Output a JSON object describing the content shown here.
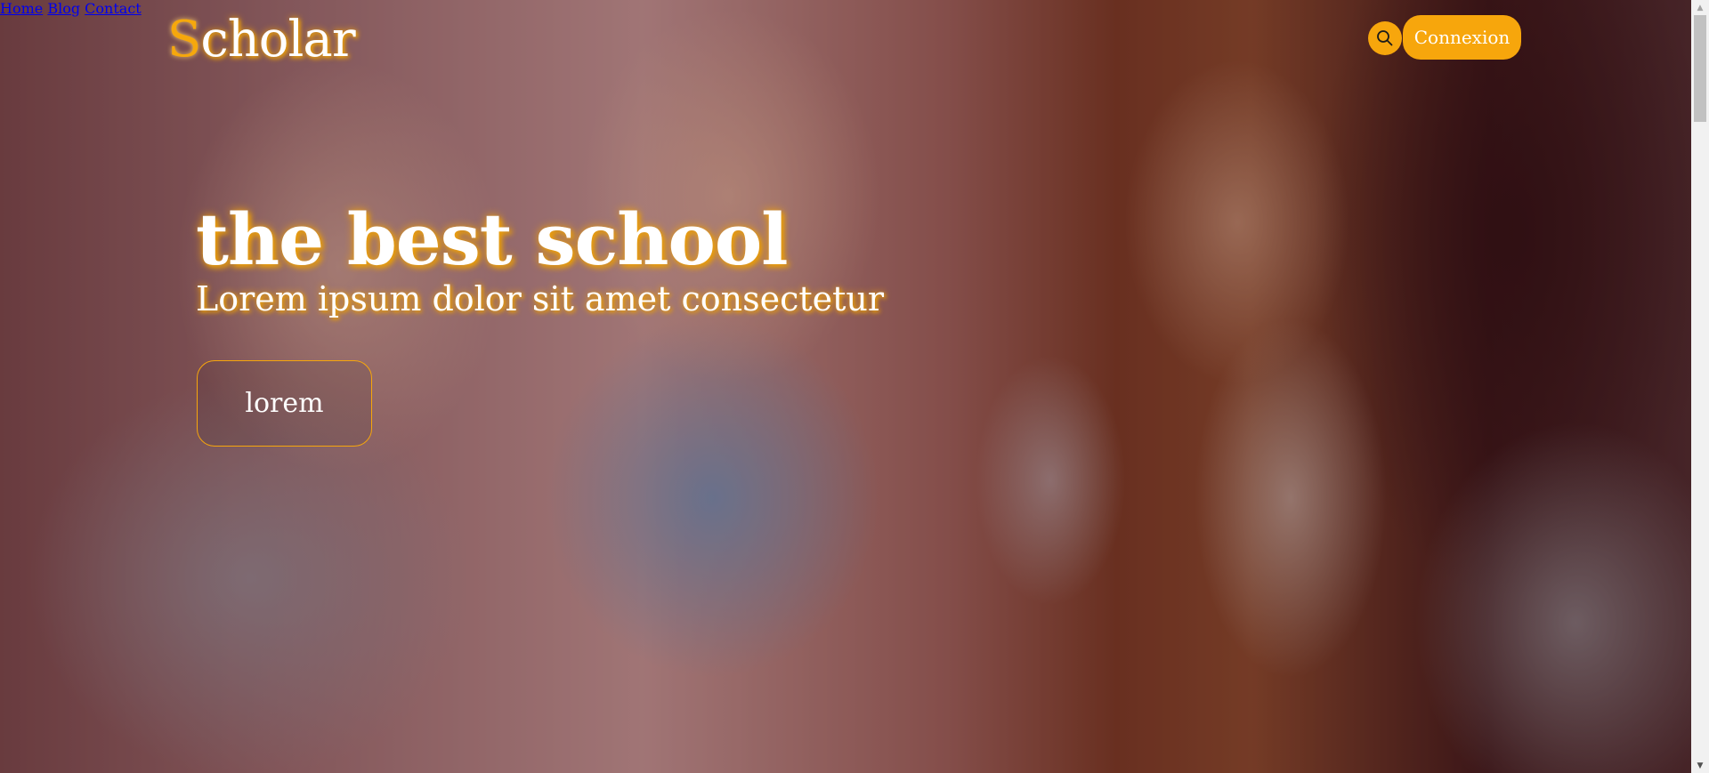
{
  "header": {
    "logo_first_letter": "S",
    "logo_rest": "cholar",
    "nav": [
      {
        "label": "Home"
      },
      {
        "label": "Blog"
      },
      {
        "label": "Contact"
      }
    ],
    "search_icon": "search-icon",
    "connexion_label": "Connexion"
  },
  "hero": {
    "title": "the best school",
    "subtitle": "Lorem ipsum dolor sit amet consectetur",
    "button_label": "lorem"
  },
  "colors": {
    "accent": "#f7a60c",
    "text": "#ffffff"
  }
}
